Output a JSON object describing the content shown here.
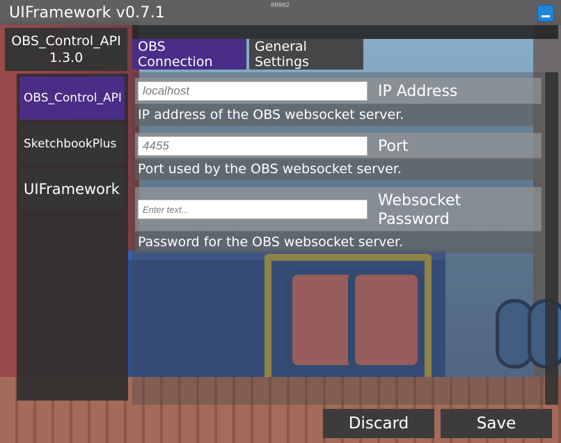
{
  "window": {
    "title": "UIFramework v0.7.1",
    "watermark": "00002",
    "minimize_icon": "minimize-icon"
  },
  "plugin_header": {
    "name": "OBS_Control_API",
    "version": "1.3.0"
  },
  "sidebar": {
    "items": [
      {
        "label": "OBS_Control_API",
        "active": true
      },
      {
        "label": "SketchbookPlus",
        "active": false
      },
      {
        "label": "UIFramework",
        "active": false
      }
    ]
  },
  "tabs": [
    {
      "label": "OBS Connection",
      "active": true
    },
    {
      "label": "General Settings",
      "active": false
    }
  ],
  "settings": [
    {
      "placeholder": "localhost",
      "label": "IP Address",
      "description": "IP address of the OBS websocket server."
    },
    {
      "placeholder": "4455",
      "label": "Port",
      "description": "Port used by the OBS websocket server."
    },
    {
      "placeholder": "Enter text...",
      "label": "Websocket Password",
      "description": "Password for the OBS websocket server."
    }
  ],
  "footer": {
    "discard_label": "Discard",
    "save_label": "Save"
  },
  "colors": {
    "accent": "#4a2d86",
    "minimize_button": "#1f86d8"
  }
}
